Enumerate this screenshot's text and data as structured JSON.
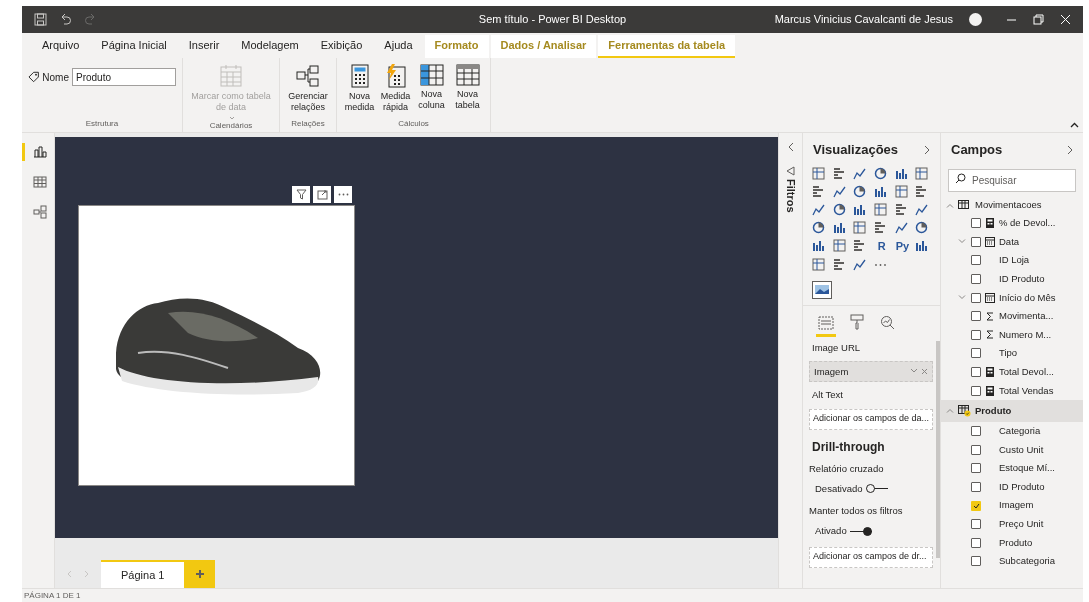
{
  "window": {
    "title": "Sem título - Power BI Desktop",
    "user": "Marcus Vinicius Cavalcanti de Jesus"
  },
  "ribbon_tabs": [
    {
      "label": "Arquivo",
      "kind": "normal",
      "selected": false
    },
    {
      "label": "Página Inicial",
      "kind": "normal",
      "selected": false
    },
    {
      "label": "Inserir",
      "kind": "normal",
      "selected": false
    },
    {
      "label": "Modelagem",
      "kind": "normal",
      "selected": false
    },
    {
      "label": "Exibição",
      "kind": "normal",
      "selected": false
    },
    {
      "label": "Ajuda",
      "kind": "normal",
      "selected": false
    },
    {
      "label": "Formato",
      "kind": "contextual",
      "selected": false
    },
    {
      "label": "Dados / Analisar",
      "kind": "contextual",
      "selected": false
    },
    {
      "label": "Ferramentas da tabela",
      "kind": "contextual",
      "selected": true
    }
  ],
  "ribbon_groups": [
    {
      "label": "Estrutura",
      "field_label": "Nome",
      "value": "Produto"
    },
    {
      "label": "Calendários",
      "buttons": [
        {
          "label": "Marcar como tabela de data",
          "kind": "calendar",
          "disabled": true,
          "dropdown": true
        }
      ]
    },
    {
      "label": "Relações",
      "buttons": [
        {
          "label": "Gerenciar relações",
          "kind": "relations",
          "disabled": false,
          "dropdown": false
        }
      ]
    },
    {
      "label": "Cálculos",
      "buttons": [
        {
          "label": "Nova medida",
          "kind": "measure",
          "disabled": false,
          "dropdown": false
        },
        {
          "label": "Medida rápida",
          "kind": "quick_measure",
          "disabled": false,
          "dropdown": false
        },
        {
          "label": "Nova coluna",
          "kind": "column",
          "disabled": false,
          "dropdown": false
        },
        {
          "label": "Nova tabela",
          "kind": "table",
          "disabled": false,
          "dropdown": false
        }
      ]
    }
  ],
  "left_nav": [
    {
      "kind": "report",
      "selected": true
    },
    {
      "kind": "data",
      "selected": false
    },
    {
      "kind": "model",
      "selected": false
    }
  ],
  "page_tabs": [
    {
      "label": "Página 1",
      "selected": true
    }
  ],
  "status_bar": "PÁGINA 1 DE 1",
  "filters_pane": {
    "label": "Filtros"
  },
  "visualizations": {
    "title": "Visualizações",
    "text_visuals": [
      "R",
      "Py"
    ],
    "pane_tabs": [
      {
        "kind": "fields",
        "selected": true
      },
      {
        "kind": "format",
        "selected": false
      },
      {
        "kind": "analytics",
        "selected": false
      }
    ],
    "wells": [
      {
        "label": "Image URL",
        "value": "Imagem"
      },
      {
        "label": "Alt Text",
        "placeholder": "Adicionar os campos de da..."
      }
    ],
    "drillthrough": {
      "title": "Drill-through",
      "settings": [
        {
          "label": "Relatório cruzado",
          "state_label": "Desativado",
          "on": false
        },
        {
          "label": "Manter todos os filtros",
          "state_label": "Ativado",
          "on": true
        }
      ],
      "placeholder": "Adicionar os campos de dr..."
    }
  },
  "fields": {
    "title": "Campos",
    "search_placeholder": "Pesquisar",
    "tables": [
      {
        "name": "Movimentacoes",
        "expanded": true,
        "selected": false,
        "in_use": false,
        "fields": [
          {
            "name": "% de Devol...",
            "kind": "measure",
            "checked": false
          },
          {
            "name": "Data",
            "kind": "hierarchy",
            "checked": false,
            "expanded": false
          },
          {
            "name": "ID Loja",
            "kind": "column",
            "checked": false
          },
          {
            "name": "ID Produto",
            "kind": "column",
            "checked": false
          },
          {
            "name": "Início do Mês",
            "kind": "hierarchy",
            "checked": false,
            "expanded": false
          },
          {
            "name": "Movimenta...",
            "kind": "sum",
            "checked": false
          },
          {
            "name": "Numero M...",
            "kind": "sum",
            "checked": false
          },
          {
            "name": "Tipo",
            "kind": "column",
            "checked": false
          },
          {
            "name": "Total Devol...",
            "kind": "measure",
            "checked": false
          },
          {
            "name": "Total Vendas",
            "kind": "measure",
            "checked": false
          }
        ]
      },
      {
        "name": "Produto",
        "expanded": true,
        "selected": true,
        "in_use": true,
        "fields": [
          {
            "name": "Categoria",
            "kind": "column",
            "checked": false
          },
          {
            "name": "Custo Unit",
            "kind": "column",
            "checked": false
          },
          {
            "name": "Estoque Mí...",
            "kind": "column",
            "checked": false
          },
          {
            "name": "ID Produto",
            "kind": "column",
            "checked": false
          },
          {
            "name": "Imagem",
            "kind": "column",
            "checked": true
          },
          {
            "name": "Preço Unit",
            "kind": "column",
            "checked": false
          },
          {
            "name": "Produto",
            "kind": "column",
            "checked": false
          },
          {
            "name": "Subcategoria",
            "kind": "column",
            "checked": false
          }
        ]
      }
    ]
  }
}
